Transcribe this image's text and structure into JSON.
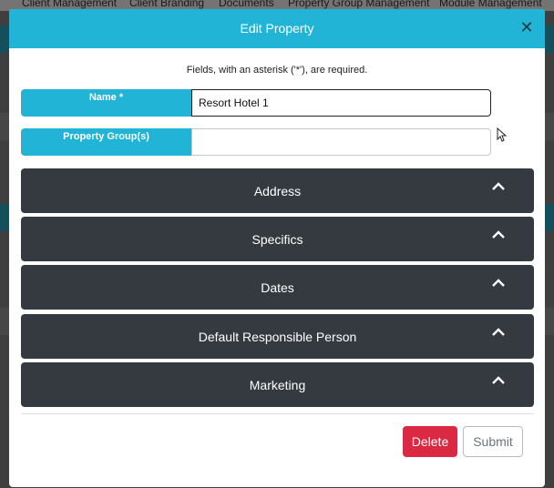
{
  "background": {
    "nav_items": [
      "Client Management",
      "Client Branding",
      "Documents",
      "Property Group Management",
      "Module Management"
    ]
  },
  "modal": {
    "title": "Edit Property",
    "close_icon": "close-icon",
    "required_note": "Fields, with an asterisk ('*'), are required.",
    "fields": [
      {
        "label": "Name *",
        "value": "Resort Hotel 1",
        "placeholder": ""
      },
      {
        "label": "Property Group(s)",
        "value": "",
        "placeholder": ""
      }
    ],
    "sections": [
      {
        "label": "Address",
        "icon": "chevron-up-icon"
      },
      {
        "label": "Specifics",
        "icon": "chevron-up-icon"
      },
      {
        "label": "Dates",
        "icon": "chevron-up-icon"
      },
      {
        "label": "Default Responsible Person",
        "icon": "chevron-up-icon"
      },
      {
        "label": "Marketing",
        "icon": "chevron-up-icon"
      }
    ],
    "buttons": {
      "delete": "Delete",
      "submit": "Submit"
    }
  },
  "colors": {
    "header": "#22b4d6",
    "panel": "#343a40",
    "delete": "#dc2943"
  }
}
